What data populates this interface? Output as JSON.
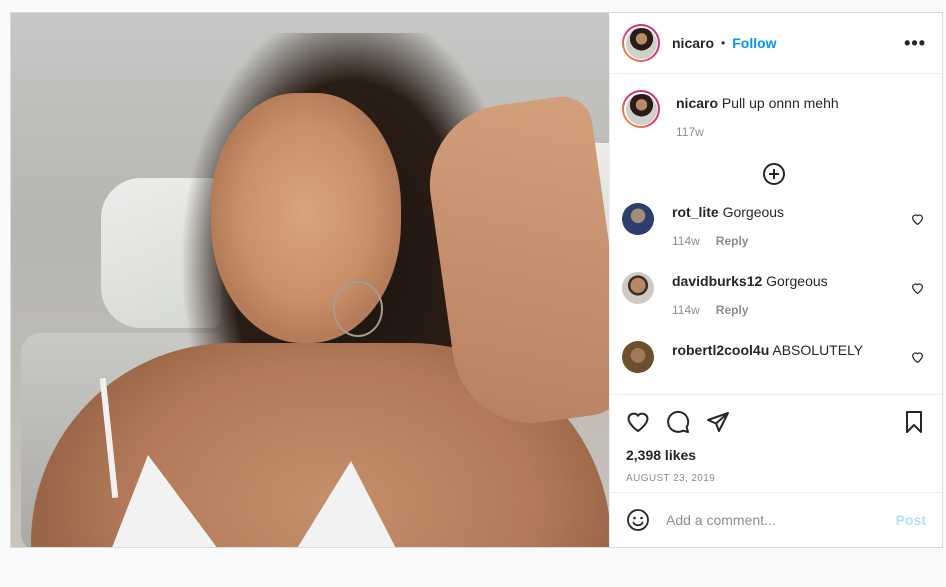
{
  "header": {
    "username": "nicaro",
    "separator": "•",
    "follow_label": "Follow",
    "more_label": "•••"
  },
  "caption": {
    "username": "nicaro",
    "text": "Pull up onnn mehh",
    "age": "117w"
  },
  "comments": [
    {
      "username": "rot_lite",
      "text": "Gorgeous",
      "age": "114w",
      "reply_label": "Reply",
      "avatar_color": "#2c3e6b"
    },
    {
      "username": "davidburks12",
      "text": "Gorgeous",
      "age": "114w",
      "reply_label": "Reply",
      "avatar_color": "#8a6a55"
    },
    {
      "username": "robertl2cool4u",
      "text": "ABSOLUTELY",
      "age": "",
      "reply_label": "",
      "avatar_color": "#6b4f2f"
    }
  ],
  "actions": {
    "icons": [
      "heart-icon",
      "comment-icon",
      "share-icon",
      "bookmark-icon"
    ]
  },
  "likes": "2,398 likes",
  "date": "AUGUST 23, 2019",
  "add_comment": {
    "placeholder": "Add a comment...",
    "post_label": "Post"
  },
  "colors": {
    "link": "#0095f6",
    "post_disabled": "#b2dffc",
    "muted": "#8e8e8e"
  }
}
